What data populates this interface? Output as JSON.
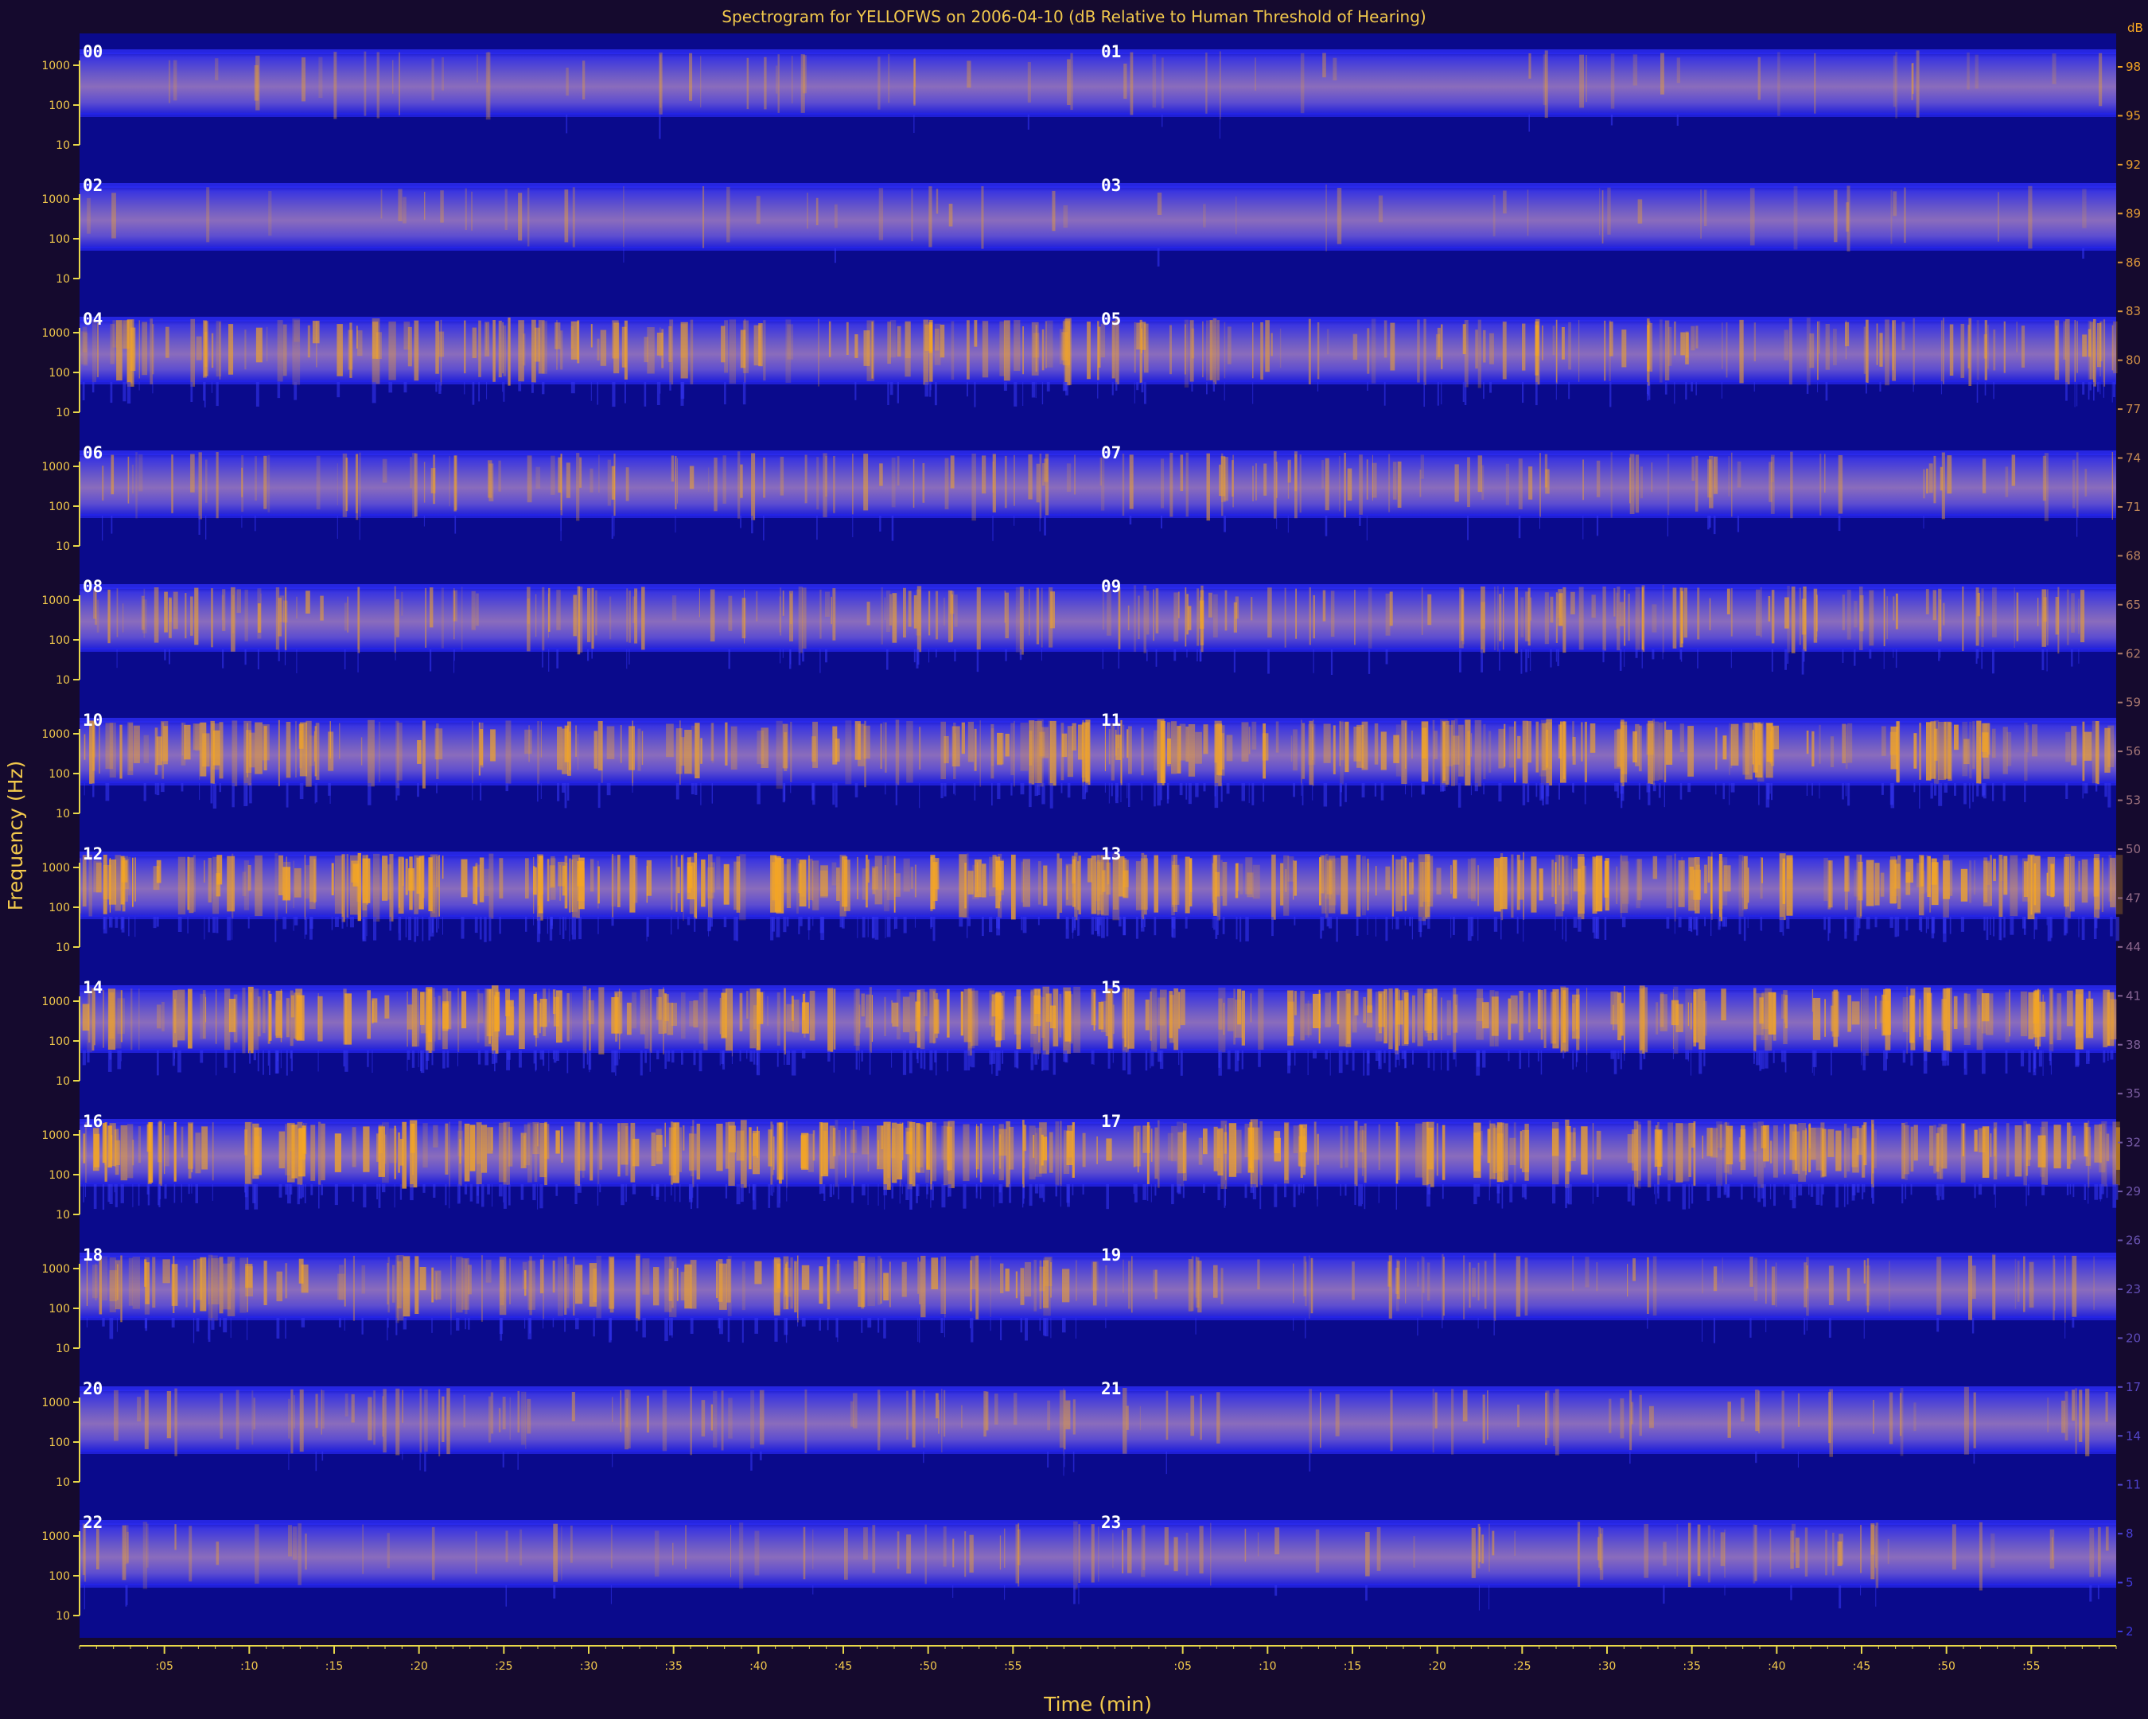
{
  "chart_data": {
    "type": "heatmap",
    "title": "Spectrogram for YELLOFWS on 2006-04-10 (dB Relative to Human Threshold of Hearing)",
    "xlabel": "Time (min)",
    "ylabel": "Frequency (Hz)",
    "rows": [
      {
        "left_hour": "00",
        "right_hour": "01",
        "freq_ticks": [
          "1000",
          "100",
          "10"
        ],
        "activity_left": 0.15,
        "activity_right": 0.12
      },
      {
        "left_hour": "02",
        "right_hour": "03",
        "freq_ticks": [
          "1000",
          "100",
          "10"
        ],
        "activity_left": 0.12,
        "activity_right": 0.1
      },
      {
        "left_hour": "04",
        "right_hour": "05",
        "freq_ticks": [
          "1000",
          "100",
          "10"
        ],
        "activity_left": 0.55,
        "activity_right": 0.5
      },
      {
        "left_hour": "06",
        "right_hour": "07",
        "freq_ticks": [
          "1000",
          "100",
          "10"
        ],
        "activity_left": 0.35,
        "activity_right": 0.35
      },
      {
        "left_hour": "08",
        "right_hour": "09",
        "freq_ticks": [
          "1000",
          "100",
          "10"
        ],
        "activity_left": 0.45,
        "activity_right": 0.5
      },
      {
        "left_hour": "10",
        "right_hour": "11",
        "freq_ticks": [
          "1000",
          "100",
          "10"
        ],
        "activity_left": 0.6,
        "activity_right": 0.7
      },
      {
        "left_hour": "12",
        "right_hour": "13",
        "freq_ticks": [
          "1000",
          "100",
          "10"
        ],
        "activity_left": 0.85,
        "activity_right": 0.8
      },
      {
        "left_hour": "14",
        "right_hour": "15",
        "freq_ticks": [
          "1000",
          "100",
          "10"
        ],
        "activity_left": 0.8,
        "activity_right": 0.75
      },
      {
        "left_hour": "16",
        "right_hour": "17",
        "freq_ticks": [
          "1000",
          "100",
          "10"
        ],
        "activity_left": 0.85,
        "activity_right": 0.75
      },
      {
        "left_hour": "18",
        "right_hour": "19",
        "freq_ticks": [
          "1000",
          "100",
          "10"
        ],
        "activity_left": 0.6,
        "activity_right": 0.3
      },
      {
        "left_hour": "20",
        "right_hour": "21",
        "freq_ticks": [
          "1000",
          "100",
          "10"
        ],
        "activity_left": 0.3,
        "activity_right": 0.2
      },
      {
        "left_hour": "22",
        "right_hour": "23",
        "freq_ticks": [
          "1000",
          "100",
          "10"
        ],
        "activity_left": 0.2,
        "activity_right": 0.25
      }
    ],
    "x_ticks": [
      ":05",
      ":10",
      ":15",
      ":20",
      ":25",
      ":30",
      ":35",
      ":40",
      ":45",
      ":50",
      ":55",
      ":05",
      ":10",
      ":15",
      ":20",
      ":25",
      ":30",
      ":35",
      ":40",
      ":45",
      ":50",
      ":55"
    ],
    "colorbar_unit": "dB",
    "colorbar_ticks": [
      "98",
      "95",
      "92",
      "89",
      "86",
      "83",
      "80",
      "77",
      "74",
      "71",
      "68",
      "65",
      "62",
      "59",
      "56",
      "53",
      "50",
      "47",
      "44",
      "41",
      "38",
      "35",
      "32",
      "29",
      "26",
      "23",
      "20",
      "17",
      "14",
      "11",
      "8",
      "5",
      "2"
    ],
    "colors": {
      "background": "#150a2e",
      "plot_background": "#0a0a8c",
      "band_low": "#2a2ad8",
      "band_high": "#f5a623",
      "axis": "#e8d84a",
      "label": "#f2c94c"
    }
  }
}
